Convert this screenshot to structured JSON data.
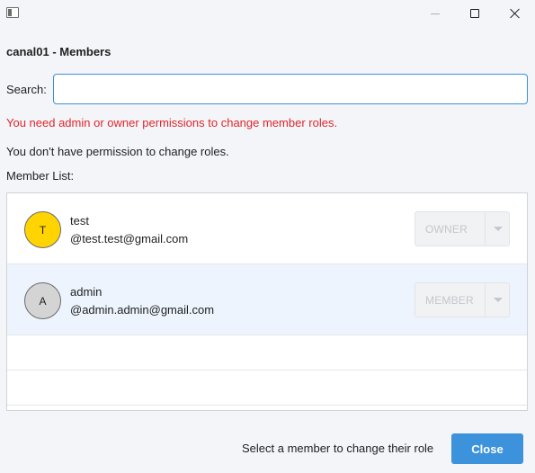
{
  "window": {
    "icons": {
      "app": "app-window-icon",
      "minimize": "minimize-icon",
      "maximize": "maximize-icon",
      "close": "close-icon"
    }
  },
  "dialog": {
    "title": "canal01 - Members",
    "search_label": "Search:",
    "search_value": "",
    "search_placeholder": "",
    "error_message": "You need admin or owner permissions to change member roles.",
    "info_message": "You don't have permission to change roles.",
    "list_label": "Member List:",
    "members": [
      {
        "initial": "T",
        "name": "test",
        "email": "@test.test@gmail.com",
        "role": "OWNER",
        "avatar_color": "#ffd400"
      },
      {
        "initial": "A",
        "name": "admin",
        "email": "@admin.admin@gmail.com",
        "role": "MEMBER",
        "avatar_color": "#d4d4d4"
      }
    ],
    "footer_hint": "Select a member to change their role",
    "close_label": "Close"
  },
  "colors": {
    "accent": "#3d92dc",
    "error": "#e0262b",
    "selected_row": "#edf4fd"
  }
}
